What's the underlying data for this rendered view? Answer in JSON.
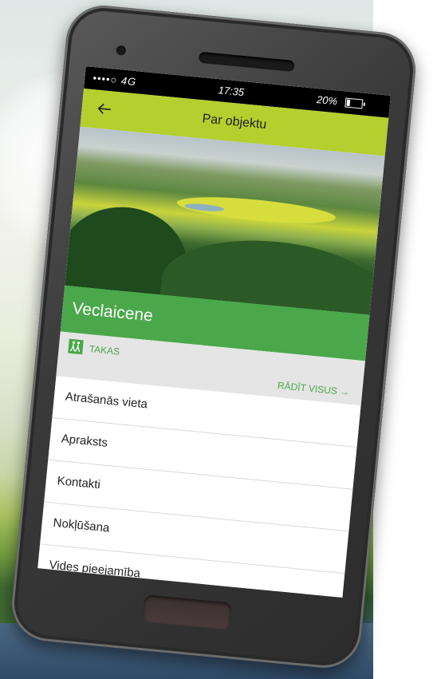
{
  "status": {
    "signal": "••••○ 4G",
    "time": "17:35",
    "battery": "20%"
  },
  "appbar": {
    "title": "Par objektu"
  },
  "object": {
    "name": "Veclaicene"
  },
  "tags": {
    "label": "TAKAS",
    "show_all": "RĀDĪT VISUS →"
  },
  "menu": {
    "items": [
      {
        "label": "Atrašanās vieta"
      },
      {
        "label": "Apraksts"
      },
      {
        "label": "Kontakti"
      },
      {
        "label": "Nokļūšana"
      },
      {
        "label": "Vides pieejamība"
      }
    ]
  },
  "colors": {
    "appbar": "#b5cf2e",
    "titlebar": "#4aa84a",
    "accent": "#4aa84a"
  }
}
